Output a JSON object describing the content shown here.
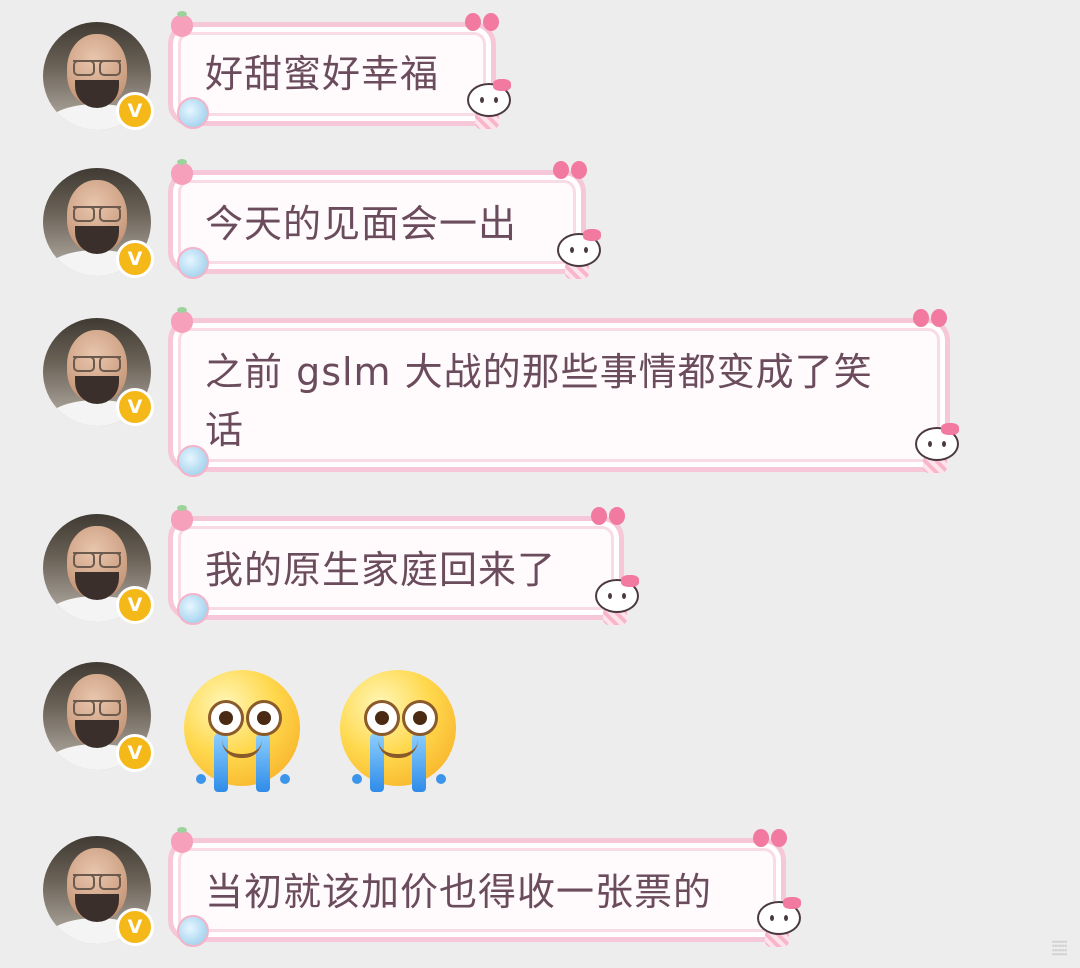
{
  "messages": [
    {
      "type": "text",
      "text": "好甜蜜好幸福"
    },
    {
      "type": "text",
      "text": "今天的见面会一出"
    },
    {
      "type": "text",
      "line1": "之前 gslm 大战的那些事情都变成了笑",
      "line2": "话"
    },
    {
      "type": "text",
      "text": "我的原生家庭回来了"
    },
    {
      "type": "emoji",
      "emoji_name": "crying-face-emoji",
      "count": 2
    },
    {
      "type": "text",
      "text": "当初就该加价也得收一张票的"
    }
  ],
  "badge": {
    "letter": "V",
    "color": "#f5b819"
  },
  "bubble_theme": {
    "border": "#f6c7d8",
    "fill": "#fffafc",
    "text_color": "#6b4c5c",
    "accent": "#f27aa0"
  },
  "watermark": "⦙⦙⦙⦙⦙⦙"
}
